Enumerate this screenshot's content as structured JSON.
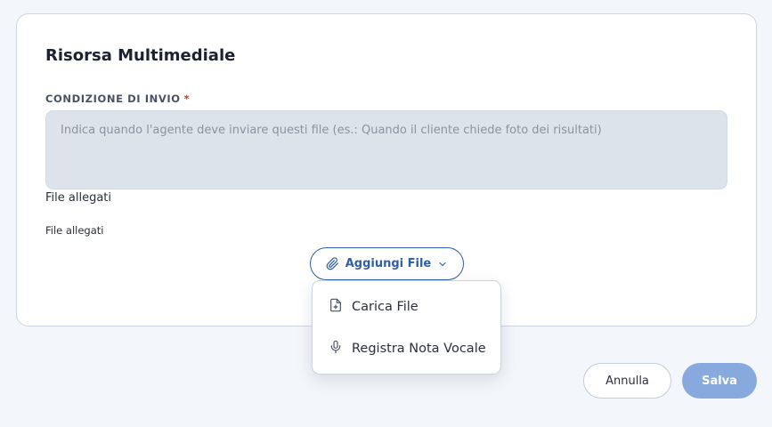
{
  "card": {
    "title": "Risorsa Multimediale"
  },
  "send_condition": {
    "label": "CONDIZIONE DI INVIO",
    "required_mark": "*",
    "placeholder": "Indica quando l'agente deve inviare questi file (es.: Quando il cliente chiede foto dei risultati)",
    "value": ""
  },
  "attachments": {
    "label_primary": "File allegati",
    "label_secondary": "File allegati"
  },
  "add_file": {
    "label": "Aggiungi File",
    "icon": "paperclip-icon",
    "chevron": "chevron-down-icon"
  },
  "dropdown": {
    "items": [
      {
        "label": "Carica File",
        "icon": "file-plus-icon"
      },
      {
        "label": "Registra Nota Vocale",
        "icon": "microphone-icon"
      }
    ]
  },
  "footer": {
    "cancel_label": "Annulla",
    "save_label": "Salva"
  },
  "colors": {
    "accent": "#2f5fa7",
    "save_button": "#88a9de",
    "required": "#c0392b",
    "input_bg": "#dde3ea"
  }
}
